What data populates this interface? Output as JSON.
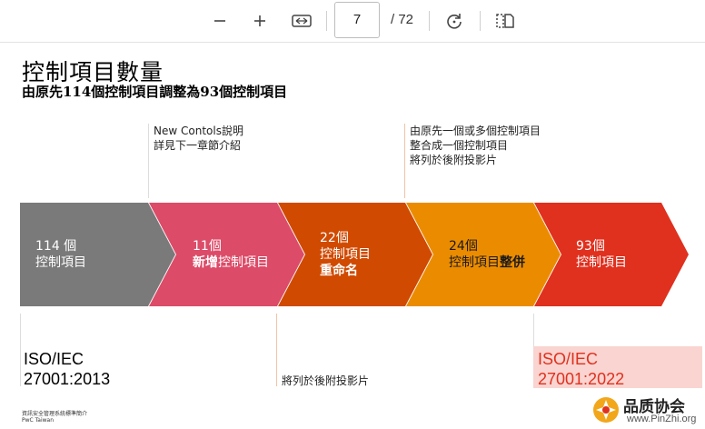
{
  "viewer": {
    "current_page": "7",
    "total_pages": "/ 72"
  },
  "slide": {
    "title": "控制項目數量",
    "subtitle": "由原先114個控制項目調整為93個控制項目",
    "notes_top": [
      {
        "lines": [
          "New Contols說明",
          "詳見下一章節介紹"
        ]
      },
      {
        "lines": [
          "由原先一個或多個控制項目",
          "整合成一個控制項目",
          "將列於後附投影片"
        ]
      }
    ],
    "note_bottom": "將列於後附投影片",
    "arrows": [
      {
        "color": "#7a7a7a",
        "line1": "114 個",
        "line2": "控制項目",
        "line3": ""
      },
      {
        "color": "#dc4b68",
        "line1": "11個",
        "line2_bold": "新增",
        "line2": "控制項目",
        "line3": ""
      },
      {
        "color": "#d04a02",
        "line1": "22個",
        "line2": "控制項目",
        "line3": "重命名"
      },
      {
        "color": "#eb8c00",
        "line1": "24個",
        "line2": "控制項目",
        "line2_bold_suffix": "整併",
        "line3": ""
      },
      {
        "color": "#e0301e",
        "line1": "93個",
        "line2": "控制項目",
        "line3": ""
      }
    ],
    "iso_old": [
      "ISO/IEC",
      "27001:2013"
    ],
    "iso_new": [
      "ISO/IEC",
      "27001:2022"
    ],
    "footer_line1": "資訊安全管理系統標準簡介",
    "footer_line2": "PwC Taiwan"
  },
  "watermark": {
    "name": "品质协会",
    "url": "www.PinZhi.org"
  },
  "colors": {
    "iso_new_bg": "#f9d4d0",
    "iso_new_text": "#e0301e",
    "note_line": "#f3c3a6"
  },
  "icons": [
    "zoom-out-icon",
    "zoom-in-icon",
    "fit-width-icon",
    "rotate-icon",
    "two-page-icon"
  ]
}
